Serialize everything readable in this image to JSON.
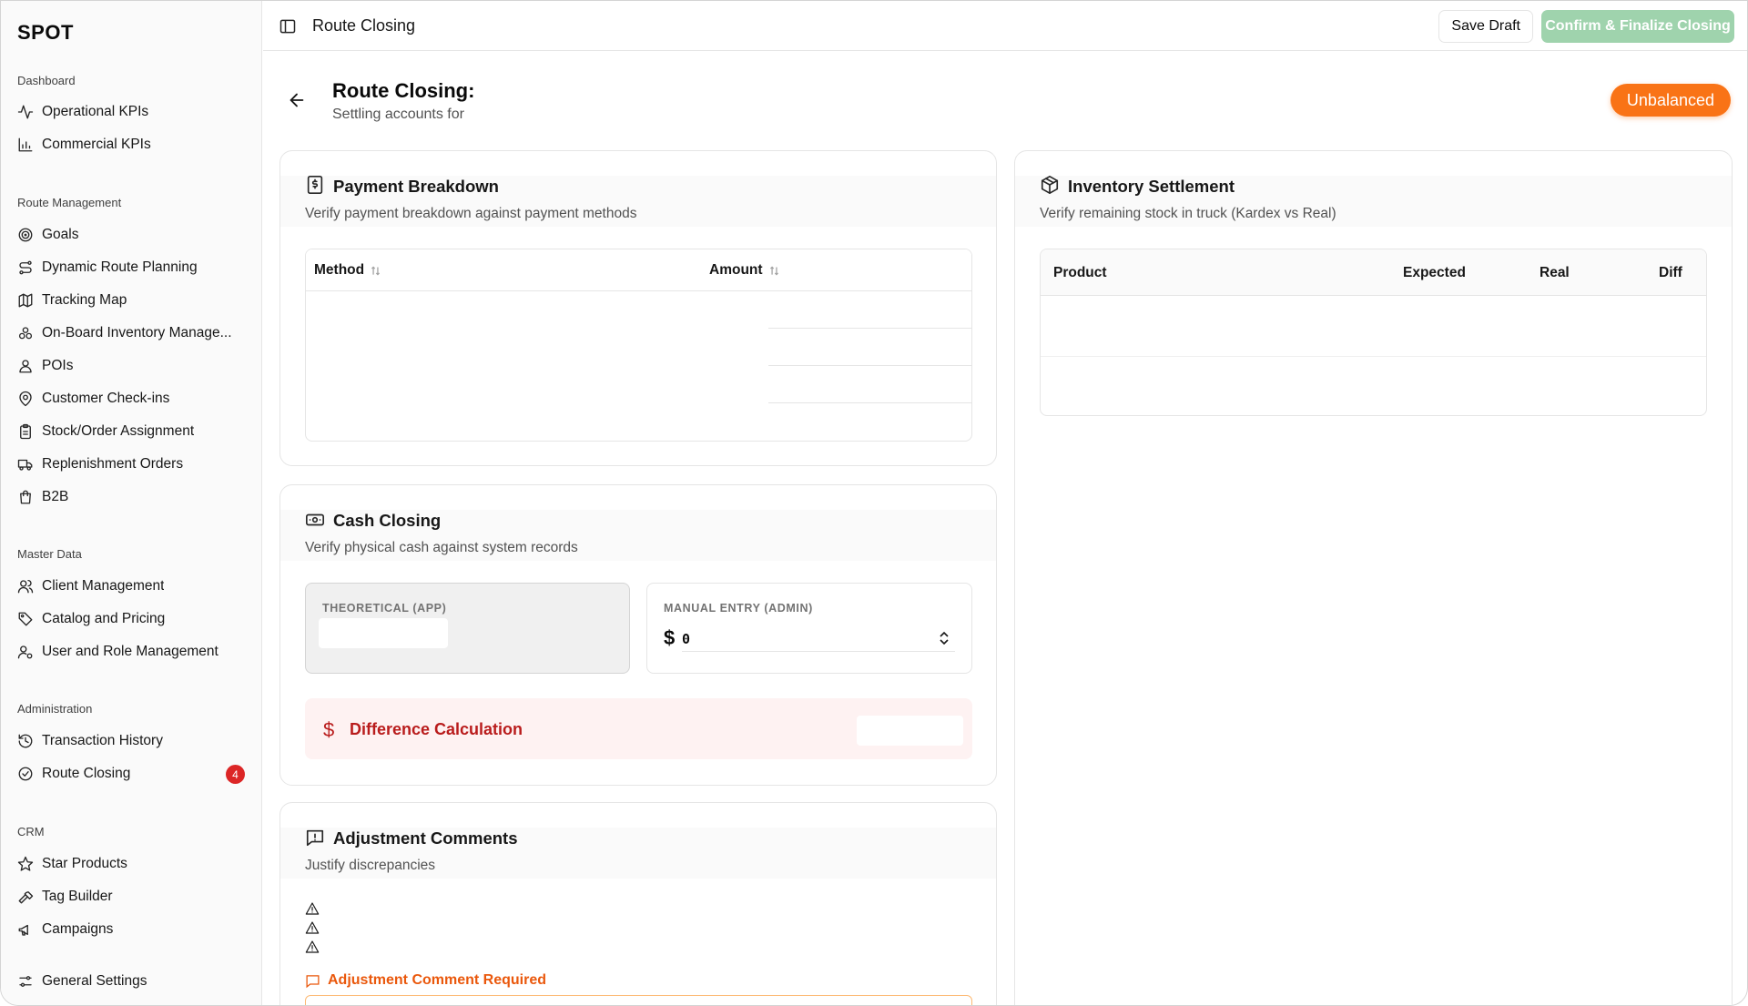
{
  "brand": "SPOT",
  "sidebar": {
    "groups": [
      {
        "title": "Dashboard",
        "items": [
          {
            "label": "Operational KPIs",
            "icon": "activity-icon"
          },
          {
            "label": "Commercial KPIs",
            "icon": "bar-chart-icon"
          }
        ]
      },
      {
        "title": "Route Management",
        "items": [
          {
            "label": "Goals",
            "icon": "target-icon"
          },
          {
            "label": "Dynamic Route Planning",
            "icon": "route-icon"
          },
          {
            "label": "Tracking Map",
            "icon": "map-icon"
          },
          {
            "label": "On-Board Inventory Manage...",
            "icon": "boxes-icon"
          },
          {
            "label": "POIs",
            "icon": "user-pin-icon"
          },
          {
            "label": "Customer Check-ins",
            "icon": "map-pin-icon"
          },
          {
            "label": "Stock/Order Assignment",
            "icon": "clipboard-icon"
          },
          {
            "label": "Replenishment Orders",
            "icon": "truck-icon"
          },
          {
            "label": "B2B",
            "icon": "shopping-bag-icon"
          }
        ]
      },
      {
        "title": "Master Data",
        "items": [
          {
            "label": "Client Management",
            "icon": "users-icon"
          },
          {
            "label": "Catalog and Pricing",
            "icon": "tag-icon"
          },
          {
            "label": "User and Role Management",
            "icon": "user-cog-icon"
          }
        ]
      },
      {
        "title": "Administration",
        "items": [
          {
            "label": "Transaction History",
            "icon": "history-icon"
          },
          {
            "label": "Route Closing",
            "icon": "check-circle-icon",
            "badge": "4"
          }
        ]
      },
      {
        "title": "CRM",
        "items": [
          {
            "label": "Star Products",
            "icon": "star-icon"
          },
          {
            "label": "Tag Builder",
            "icon": "hammer-icon"
          },
          {
            "label": "Campaigns",
            "icon": "megaphone-icon"
          }
        ]
      }
    ],
    "footer_item": {
      "label": "General Settings",
      "icon": "settings-sliders-icon"
    }
  },
  "header": {
    "title": "Route Closing",
    "save_label": "Save Draft",
    "confirm_label": "Confirm & Finalize Closing"
  },
  "page": {
    "title": "Route Closing:",
    "subtitle": "Settling accounts for",
    "status": "Unbalanced"
  },
  "payment": {
    "title": "Payment Breakdown",
    "desc": "Verify payment breakdown against payment methods",
    "columns": [
      "Method",
      "Amount"
    ]
  },
  "inventory": {
    "title": "Inventory Settlement",
    "desc": "Verify remaining stock in truck (Kardex vs Real)",
    "columns": [
      "Product",
      "Expected",
      "Real",
      "Diff"
    ]
  },
  "cash": {
    "title": "Cash Closing",
    "desc": "Verify physical cash against system records",
    "theoretical_label": "THEORETICAL (APP)",
    "manual_label": "MANUAL ENTRY (ADMIN)",
    "currency": "$",
    "manual_value": "0",
    "difference_title": "Difference Calculation"
  },
  "comments": {
    "title": "Adjustment Comments",
    "desc": "Justify discrepancies",
    "required_label": "Adjustment Comment Required"
  },
  "colors": {
    "accent_orange": "#f97316",
    "confirm_green": "#9fd3ad",
    "danger_red": "#b91c1c",
    "badge_red": "#dc2626"
  }
}
